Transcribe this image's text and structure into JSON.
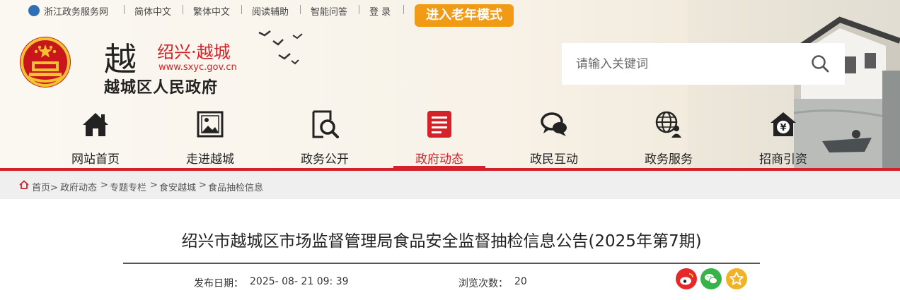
{
  "topbar": {
    "portal": "浙江政务服务网",
    "simplified": "简体中文",
    "traditional": "繁体中文",
    "reading_aid": "阅读辅助",
    "smart_qa": "智能问答",
    "login": "登 录",
    "elder_mode": "进入老年模式"
  },
  "site": {
    "logo_char": "越",
    "city": "绍兴·越城",
    "url": "www.sxyc.gov.cn",
    "name": "越城区人民政府"
  },
  "search": {
    "placeholder": "请输入关键词",
    "icon": "search-icon"
  },
  "nav": {
    "items": [
      {
        "label": "网站首页",
        "icon": "home-icon"
      },
      {
        "label": "走进越城",
        "icon": "picture-icon"
      },
      {
        "label": "政务公开",
        "icon": "document-search-icon"
      },
      {
        "label": "政府动态",
        "icon": "news-icon"
      },
      {
        "label": "政民互动",
        "icon": "chat-icon"
      },
      {
        "label": "政务服务",
        "icon": "globe-user-icon"
      },
      {
        "label": "招商引资",
        "icon": "yen-house-icon"
      }
    ],
    "active_index": 3
  },
  "breadcrumb": {
    "items": [
      "首页>",
      "政府动态",
      ">",
      "专题专栏",
      ">",
      "食安越城",
      ">",
      "食品抽检信息"
    ]
  },
  "article": {
    "title": "绍兴市越城区市场监督管理局食品安全监督抽检信息公告(2025年第7期)",
    "publish_label": "发布日期：",
    "publish_date": "2025- 08- 21 09: 39",
    "views_label": "浏览次数：",
    "views": "20"
  },
  "share": [
    {
      "name": "weibo-icon",
      "color": "#e6282b"
    },
    {
      "name": "wechat-icon",
      "color": "#37b34a"
    },
    {
      "name": "favorite-icon",
      "color": "#f2b224"
    }
  ],
  "colors": {
    "accent": "#d3222a",
    "elder": "#f09a15",
    "portal_blue": "#2f6fb6"
  }
}
